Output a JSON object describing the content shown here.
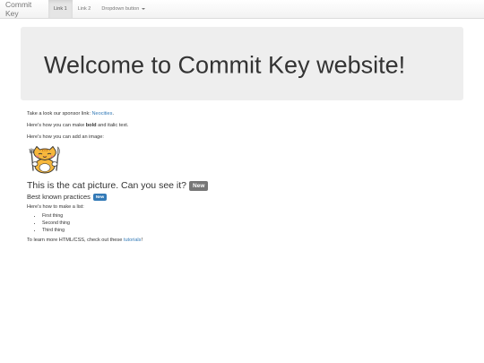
{
  "navbar": {
    "brand": "Commit Key",
    "links": [
      {
        "label": "Link 1",
        "active": true
      },
      {
        "label": "Link 2",
        "active": false
      }
    ],
    "dropdown_label": "Dropdown button"
  },
  "jumbotron": {
    "title": "Welcome to Commit Key website!"
  },
  "content": {
    "sponsor_prefix": "Take a look our sponsor link: ",
    "sponsor_link": "Neocities",
    "sponsor_suffix": ".",
    "bold_prefix": "Here's how you can make ",
    "bold_word": "bold",
    "bold_middle": " and ",
    "italic_word": "italic",
    "bold_suffix": " text.",
    "image_intro": "Here's how you can add an image:",
    "cat_heading": "This is the cat picture. Can you see it?",
    "cat_badge": "New",
    "practices_heading": "Best known practices",
    "practices_badge": "New",
    "list_intro": "Here's how to make a list:",
    "list_items": [
      "First thing",
      "Second thing",
      "Third thing"
    ],
    "learn_prefix": "To learn more HTML/CSS, check out these ",
    "learn_link": "tutorials",
    "learn_suffix": "!"
  },
  "colors": {
    "link": "#337ab7",
    "jumbotron_bg": "#eeeeee",
    "badge_gray": "#777777",
    "badge_blue": "#337ab7"
  },
  "icons": {
    "cat_image": "cat-mascot-image",
    "dropdown_caret": "caret-down-icon"
  }
}
